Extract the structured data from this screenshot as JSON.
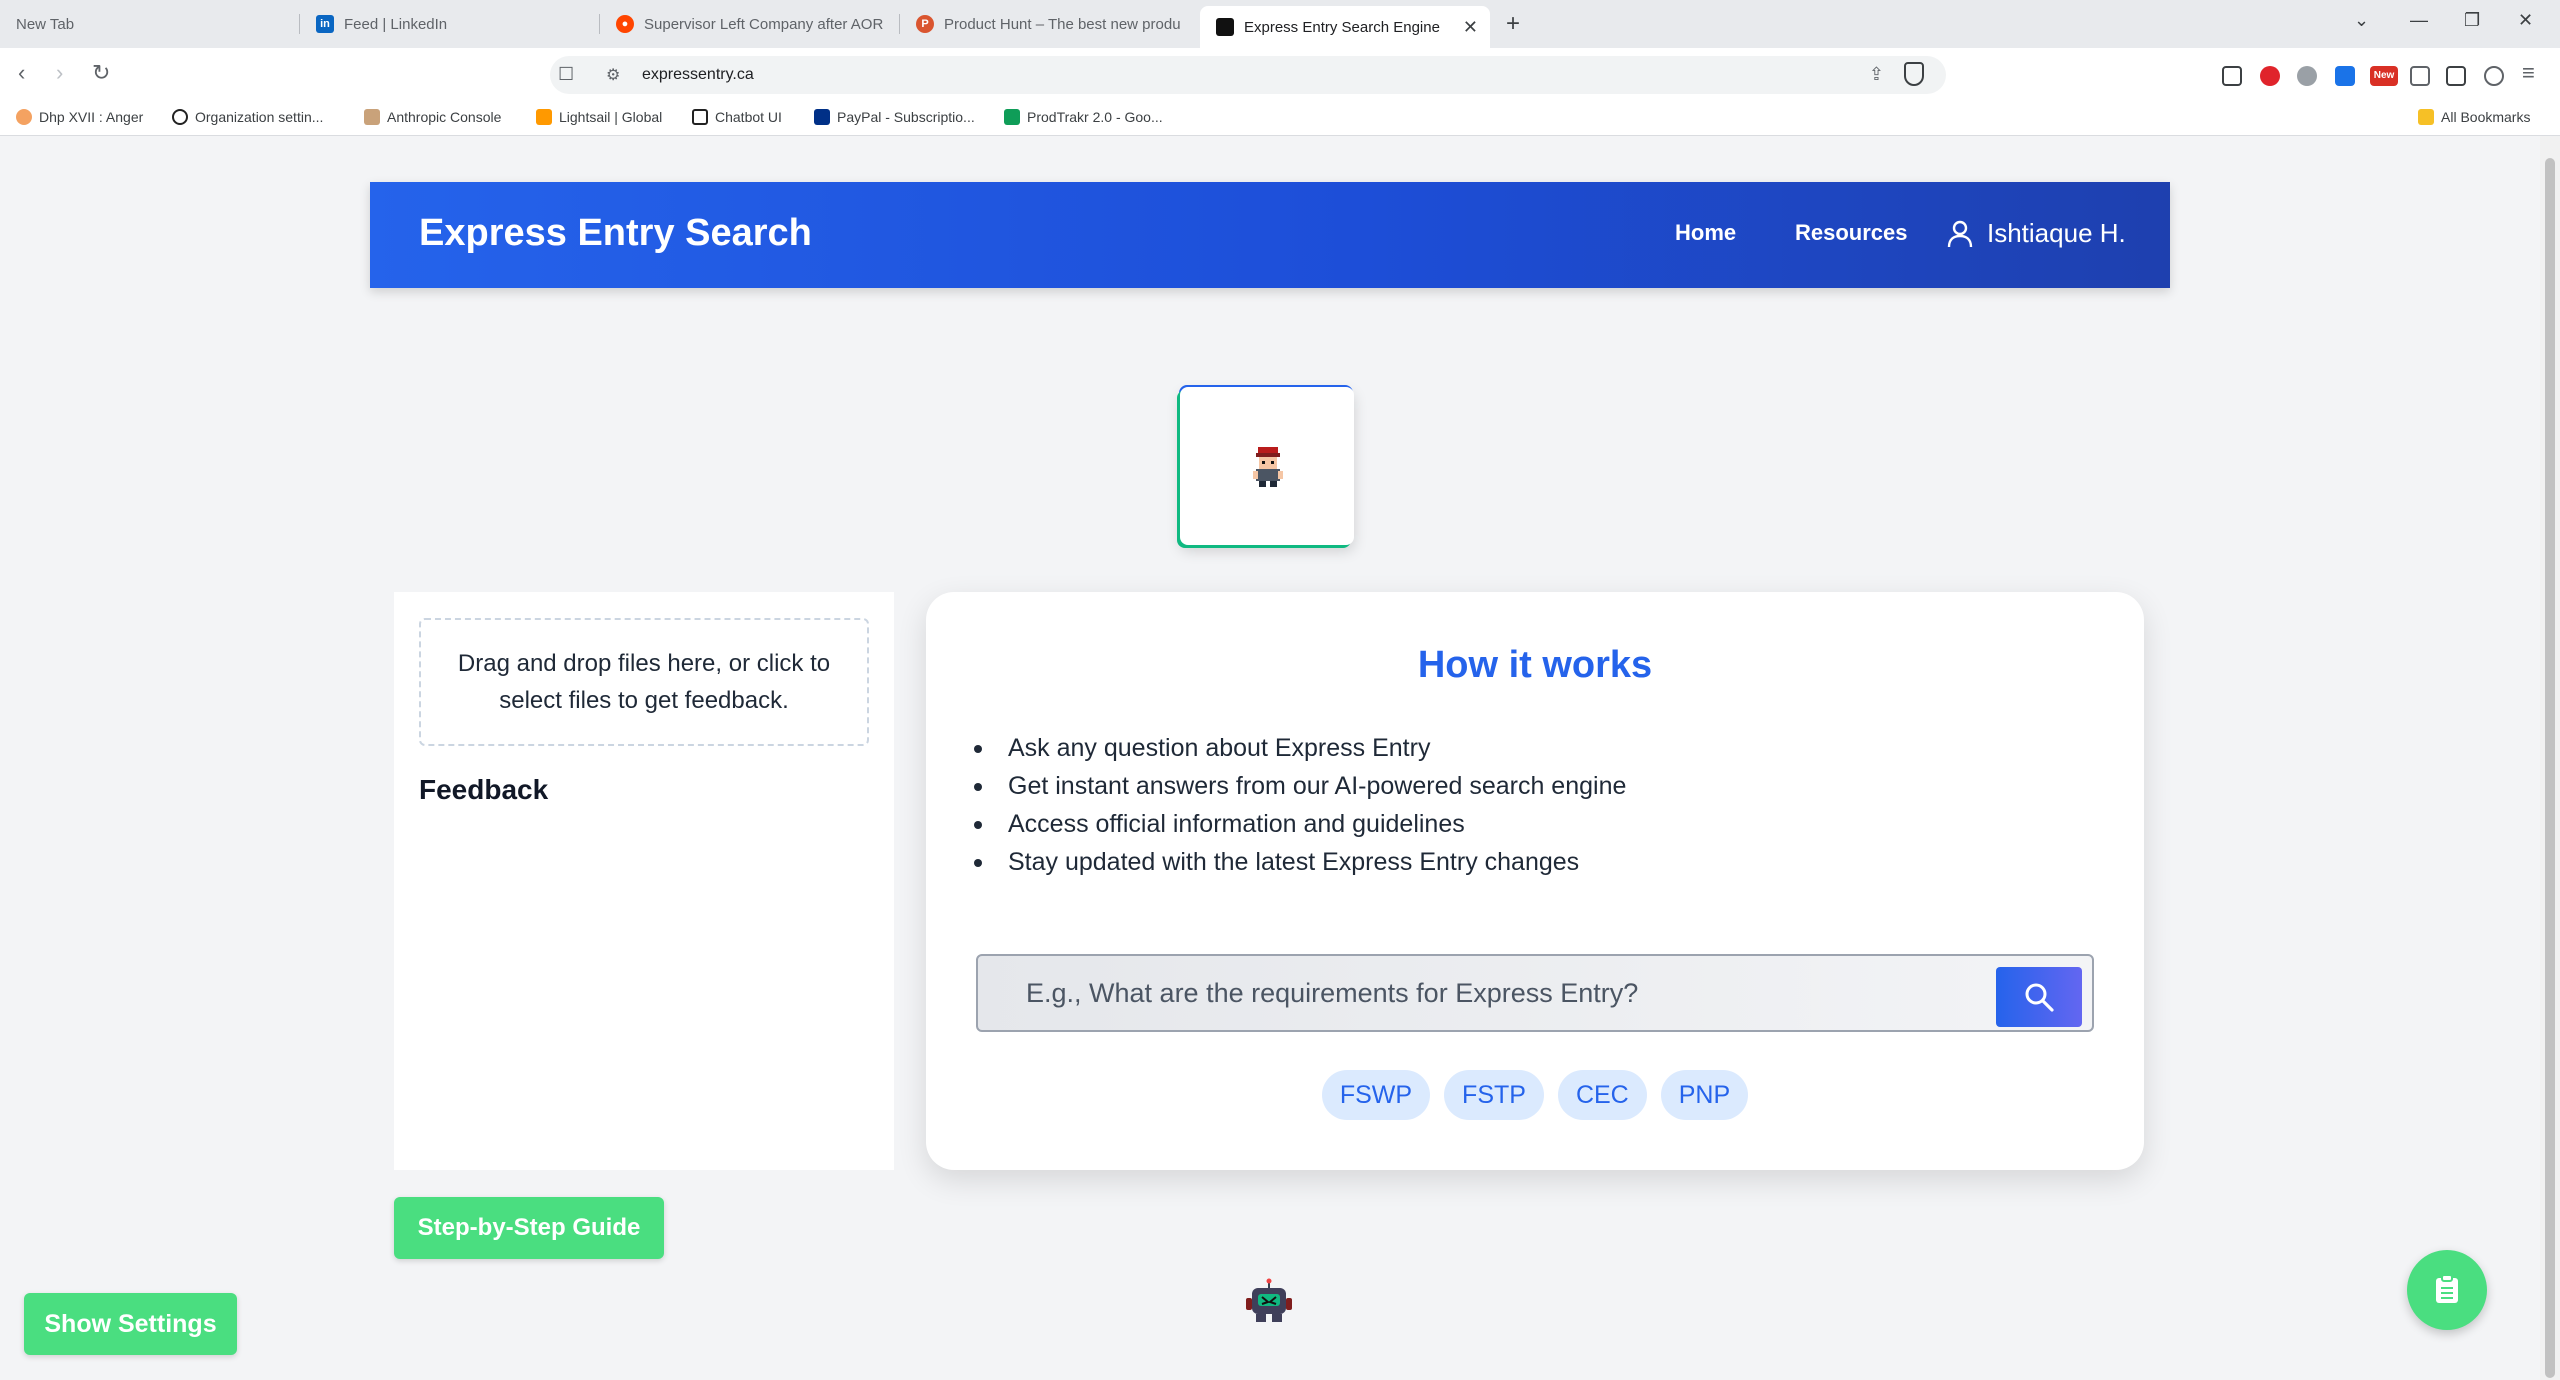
{
  "browser": {
    "tabs": [
      {
        "label": "New Tab"
      },
      {
        "label": "Feed | LinkedIn"
      },
      {
        "label": "Supervisor Left Company after AOR"
      },
      {
        "label": "Product Hunt – The best new produ"
      },
      {
        "label": "Express Entry Search Engine"
      }
    ],
    "url": "expressentry.ca",
    "bookmarks": [
      {
        "label": "Dhp XVII : Anger"
      },
      {
        "label": "Organization settin..."
      },
      {
        "label": "Anthropic Console"
      },
      {
        "label": "Lightsail | Global"
      },
      {
        "label": "Chatbot UI"
      },
      {
        "label": "PayPal - Subscriptio..."
      },
      {
        "label": "ProdTrakr 2.0 - Goo..."
      }
    ],
    "all_bookmarks": "All Bookmarks",
    "ext_badge": "New"
  },
  "header": {
    "brand": "Express Entry Search",
    "nav": {
      "home": "Home",
      "resources": "Resources"
    },
    "user": "Ishtiaque H."
  },
  "upload": {
    "dropzone_text": "Drag and drop files here, or click to select files to get feedback.",
    "feedback_title": "Feedback"
  },
  "how": {
    "title": "How it works",
    "items": [
      "Ask any question about Express Entry",
      "Get instant answers from our AI-powered search engine",
      "Access official information and guidelines",
      "Stay updated with the latest Express Entry changes"
    ],
    "search_placeholder": "E.g., What are the requirements for Express Entry?",
    "chips": [
      "FSWP",
      "FSTP",
      "CEC",
      "PNP"
    ]
  },
  "buttons": {
    "guide": "Step-by-Step Guide",
    "settings": "Show Settings"
  },
  "colors": {
    "header_start": "#2563eb",
    "header_end": "#1e40af",
    "accent": "#2563eb",
    "green": "#4ade80"
  }
}
